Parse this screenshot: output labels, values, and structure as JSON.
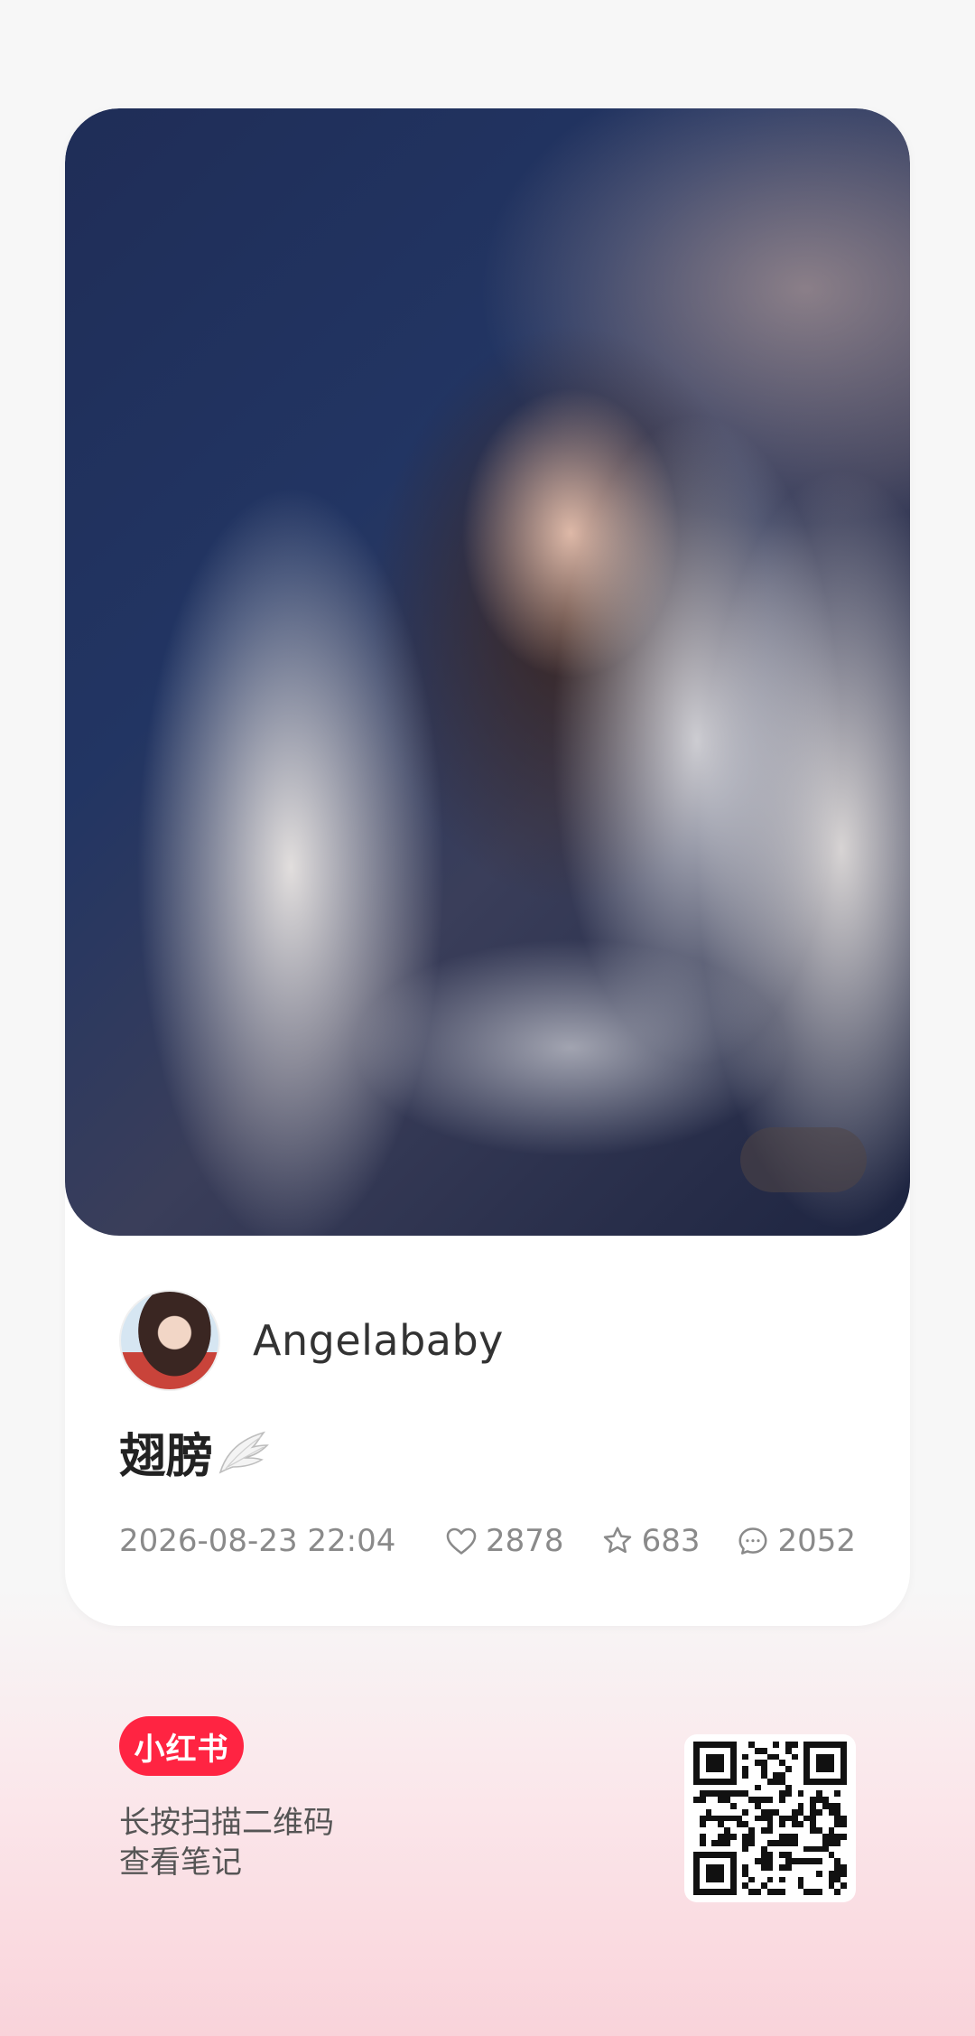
{
  "post": {
    "author_name": "Angelababy",
    "title_text": "翅膀",
    "title_emoji": "wing-emoji",
    "date": "2026-08-23 22:04",
    "likes": "2878",
    "collects": "683",
    "comments": "2052"
  },
  "footer": {
    "brand": "小红书",
    "line1": "长按扫描二维码",
    "line2": "查看笔记"
  },
  "icons": {
    "like": "heart-icon",
    "collect": "star-icon",
    "comment": "comment-icon"
  },
  "colors": {
    "brand": "#ff2442",
    "meta_text": "#8a8a8a",
    "card_bg": "#ffffff"
  }
}
